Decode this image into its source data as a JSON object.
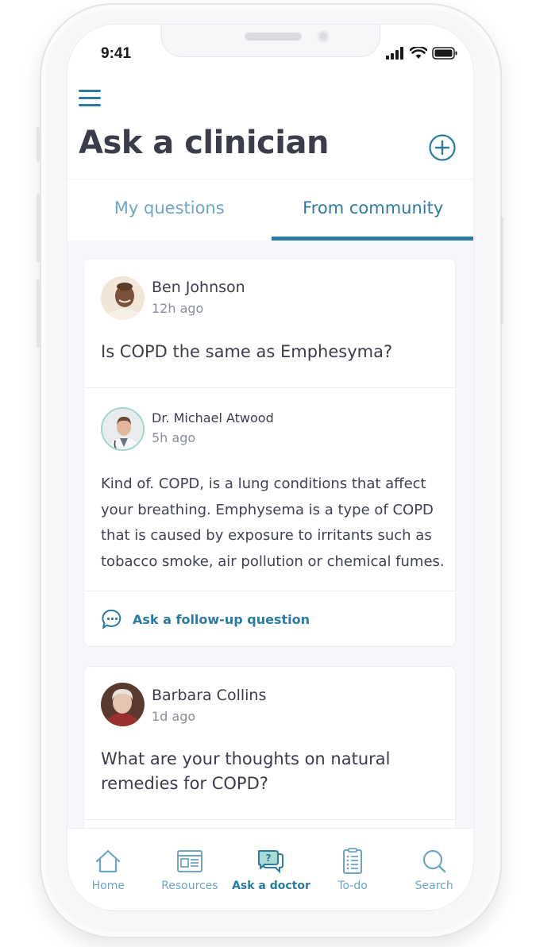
{
  "status_bar": {
    "time": "9:41"
  },
  "header": {
    "title": "Ask a clinician"
  },
  "tabs": [
    {
      "label": "My questions",
      "active": false
    },
    {
      "label": "From community",
      "active": true
    }
  ],
  "posts": [
    {
      "author": "Ben Johnson",
      "posted": "12h ago",
      "question": "Is COPD the same as Emphesyma?",
      "answer": {
        "author": "Dr. Michael Atwood",
        "posted": "5h ago",
        "text": "Kind of. COPD, is a lung conditions that affect your breathing. Emphysema is a type of COPD that is caused by exposure to irritants such as tobacco smoke, air pollution or chemical fumes."
      },
      "follow_up_label": "Ask a follow-up question"
    },
    {
      "author": "Barbara Collins",
      "posted": "1d ago",
      "question": "What are your thoughts on natural remedies for COPD?"
    }
  ],
  "bottom_nav": [
    {
      "label": "Home",
      "icon": "home-icon",
      "active": false
    },
    {
      "label": "Resources",
      "icon": "resources-icon",
      "active": false
    },
    {
      "label": "Ask a doctor",
      "icon": "chat-question-icon",
      "active": true
    },
    {
      "label": "To-do",
      "icon": "clipboard-icon",
      "active": false
    },
    {
      "label": "Search",
      "icon": "search-icon",
      "active": false
    }
  ],
  "colors": {
    "accent": "#2b7ba3",
    "accent_light": "#6ea5c7",
    "text": "#3b3d4b",
    "muted": "#8a8e99"
  }
}
